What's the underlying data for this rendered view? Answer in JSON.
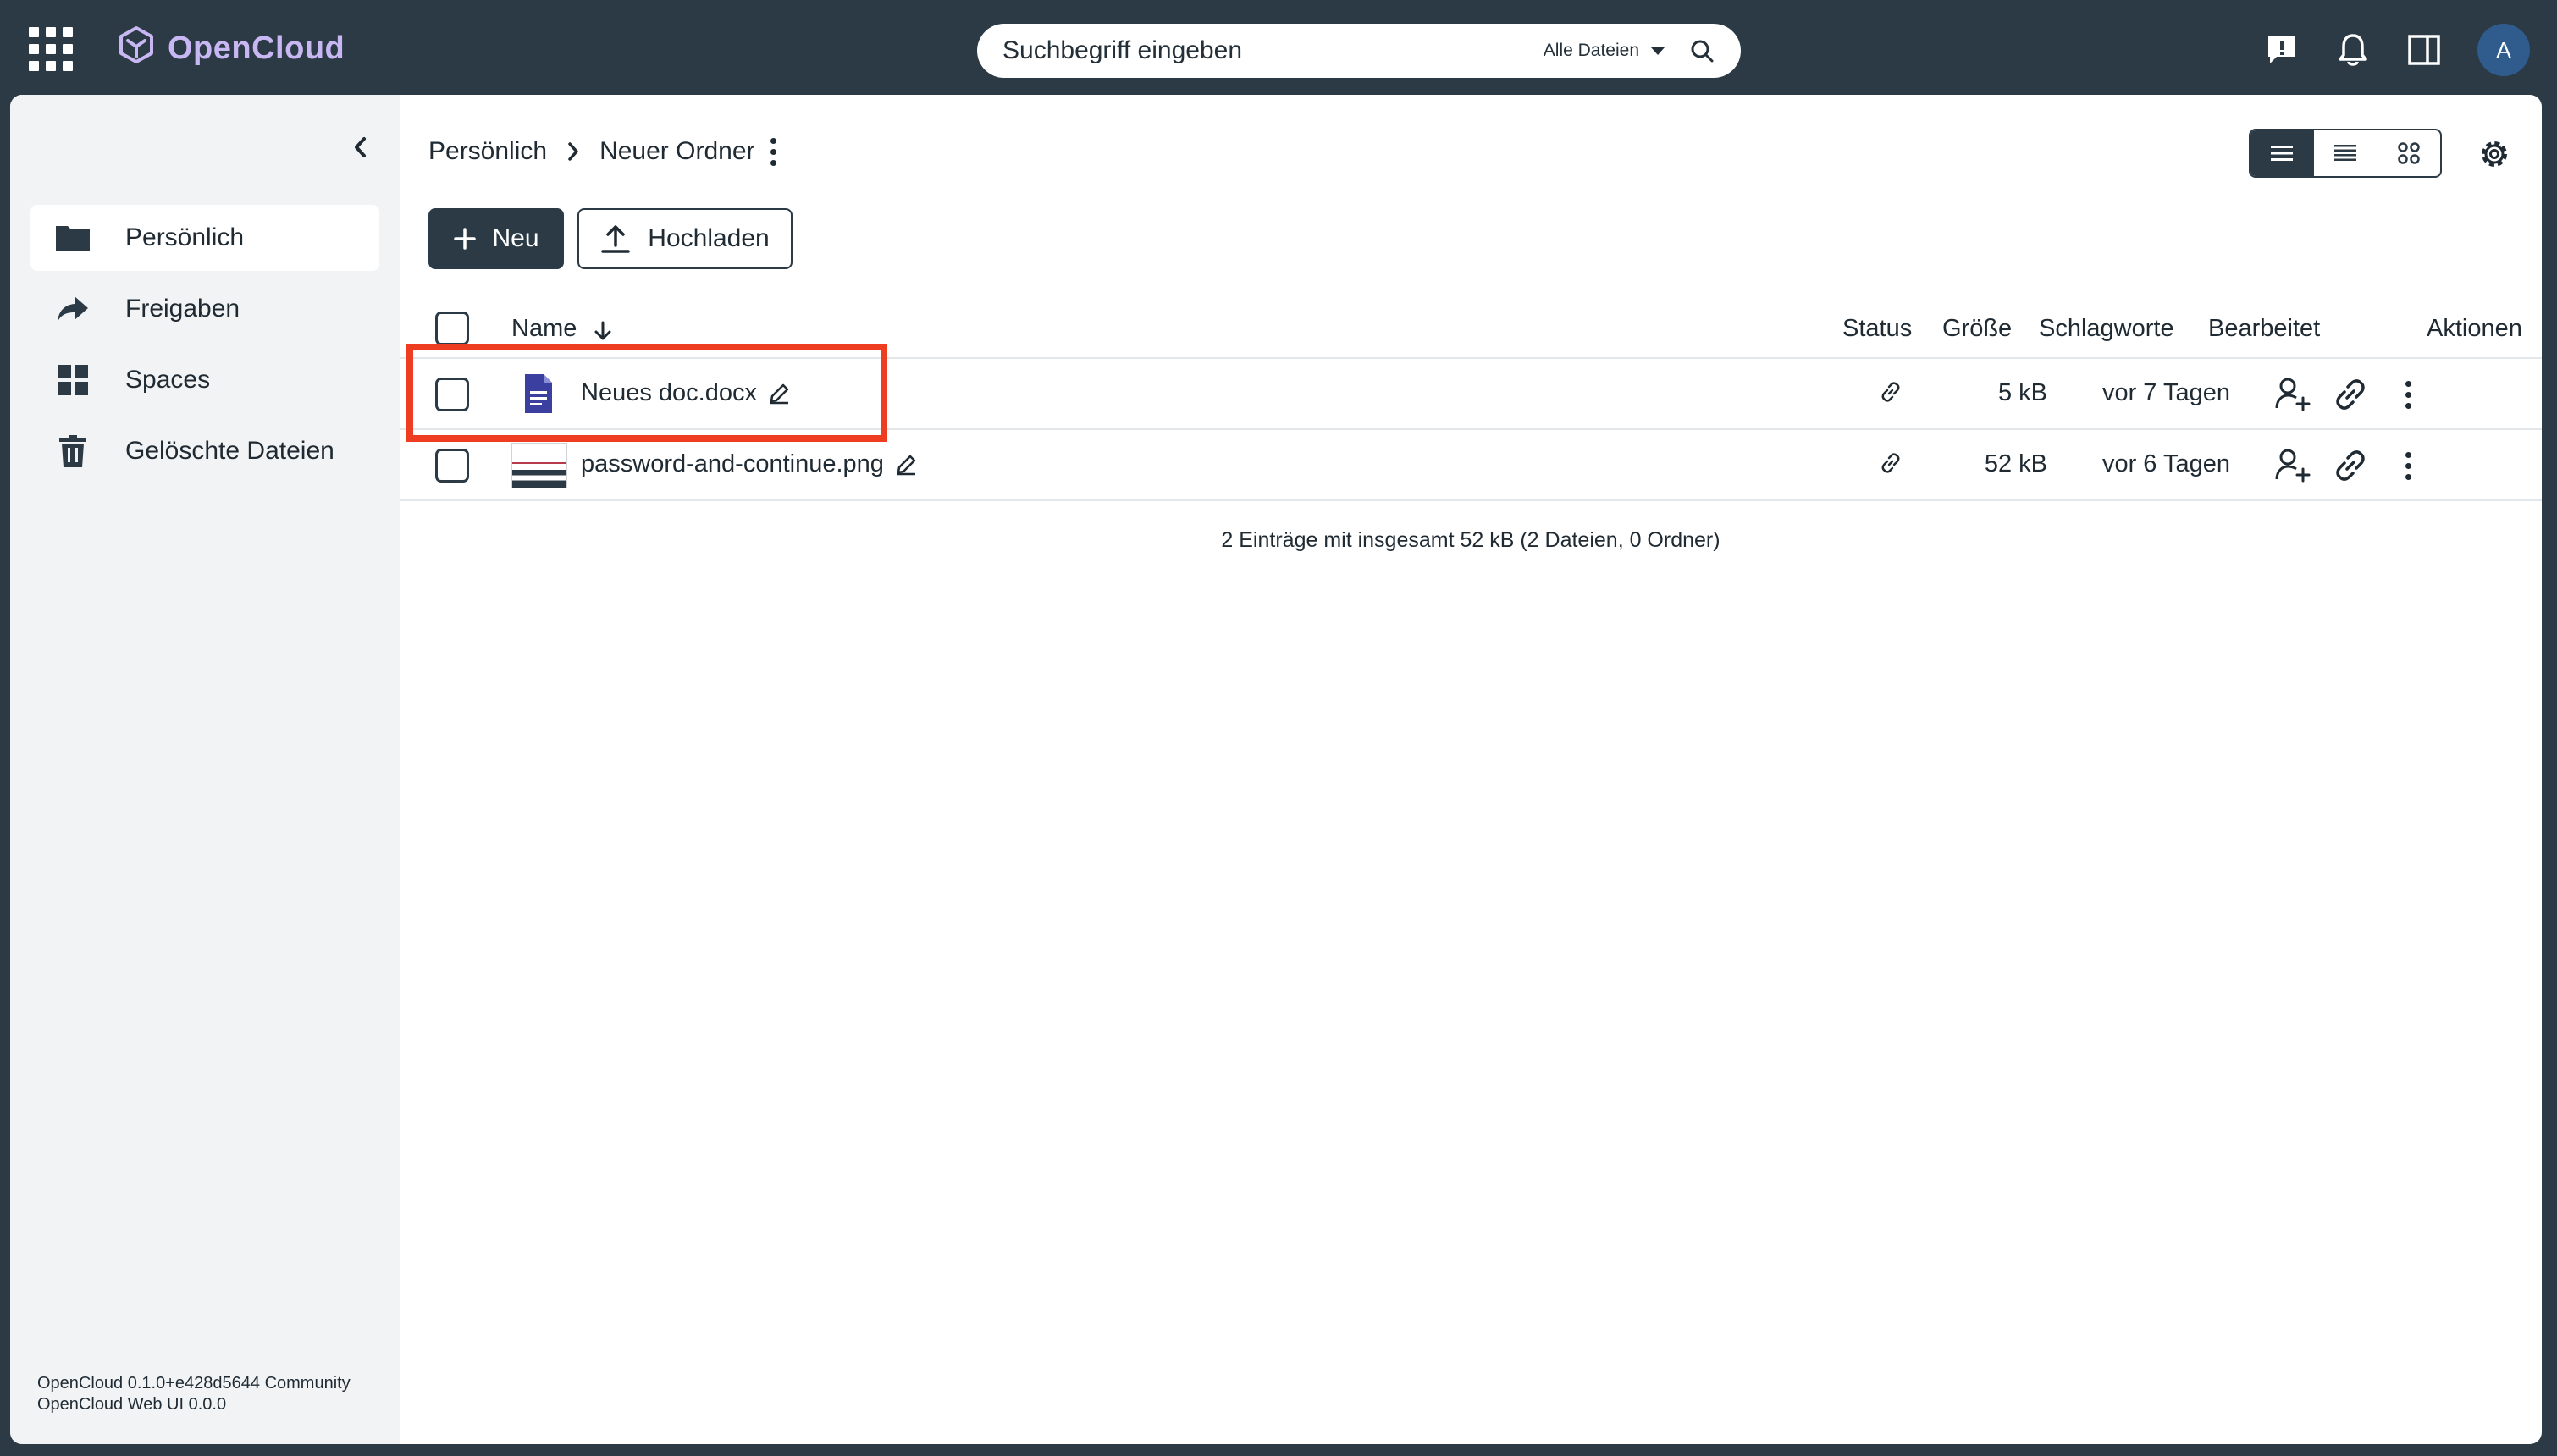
{
  "app": {
    "name": "OpenCloud",
    "logo_color": "#c8b7f2",
    "topbar_color": "#2b3a45"
  },
  "search": {
    "placeholder": "Suchbegriff eingeben",
    "scope": "Alle Dateien"
  },
  "user": {
    "avatar_initial": "A"
  },
  "sidebar": {
    "items": [
      {
        "label": "Persönlich",
        "icon": "folder-icon",
        "active": true
      },
      {
        "label": "Freigaben",
        "icon": "share-icon",
        "active": false
      },
      {
        "label": "Spaces",
        "icon": "grid-icon",
        "active": false
      },
      {
        "label": "Gelöschte Dateien",
        "icon": "trash-icon",
        "active": false
      }
    ],
    "version_line1": "OpenCloud 0.1.0+e428d5644 Community",
    "version_line2": "OpenCloud Web UI 0.0.0"
  },
  "breadcrumb": {
    "items": [
      "Persönlich",
      "Neuer Ordner"
    ]
  },
  "toolbar": {
    "new_label": "Neu",
    "upload_label": "Hochladen"
  },
  "table": {
    "headers": {
      "name": "Name",
      "status": "Status",
      "size": "Größe",
      "tags": "Schlagworte",
      "modified": "Bearbeitet",
      "actions": "Aktionen"
    },
    "rows": [
      {
        "name": "Neues doc.docx",
        "type": "document",
        "size": "5 kB",
        "modified": "vor 7 Tagen"
      },
      {
        "name": "password-and-continue.png",
        "type": "image",
        "size": "52 kB",
        "modified": "vor 6 Tagen"
      }
    ],
    "summary": "2 Einträge mit insgesamt 52 kB (2 Dateien, 0 Ordner)"
  },
  "highlight_color": "#ef3d22"
}
